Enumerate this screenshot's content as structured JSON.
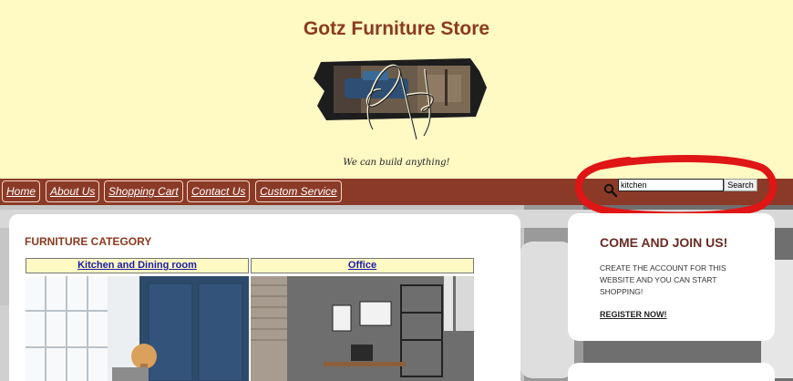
{
  "header": {
    "title": "Gotz Furniture Store",
    "tagline": "We can build anything!"
  },
  "nav": {
    "items": [
      {
        "label": "Home"
      },
      {
        "label": "About Us"
      },
      {
        "label": "Shopping Cart"
      },
      {
        "label": "Contact Us"
      },
      {
        "label": "Custom Service"
      }
    ]
  },
  "search": {
    "value": "kitchen",
    "button_label": "Search"
  },
  "main": {
    "section_title": "FURNITURE CATEGORY",
    "categories": [
      {
        "label": "Kitchen and Dining room"
      },
      {
        "label": "Office"
      }
    ]
  },
  "sidebar": {
    "title": "COME AND JOIN US!",
    "text": "Create the account for this website and you can start shopping!",
    "link": "REGISTER NOW!"
  },
  "colors": {
    "background": "#fff9c4",
    "nav": "#8b3a27",
    "title": "#8b3a1e",
    "annotation": "#e01515"
  }
}
